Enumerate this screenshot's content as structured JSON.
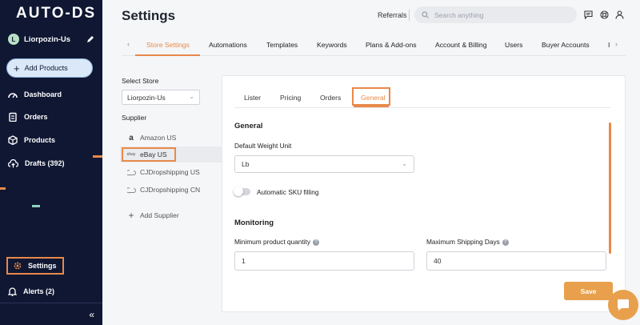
{
  "sidebar": {
    "logo": "AUTO-DS",
    "user": {
      "initial": "L",
      "name": "Liorpozin-Us"
    },
    "add_products": "Add Products",
    "nav": [
      {
        "label": "Dashboard",
        "icon": "speedometer-icon"
      },
      {
        "label": "Orders",
        "icon": "clipboard-icon"
      },
      {
        "label": "Products",
        "icon": "box-icon"
      },
      {
        "label": "Drafts (392)",
        "icon": "cloud-upload-icon"
      }
    ],
    "settings": "Settings",
    "alerts": "Alerts (2)",
    "collapse": "«"
  },
  "header": {
    "title": "Settings",
    "referrals": "Referrals",
    "search_placeholder": "Search anything"
  },
  "tabs": [
    {
      "label": "Store Settings",
      "active": true
    },
    {
      "label": "Automations"
    },
    {
      "label": "Templates"
    },
    {
      "label": "Keywords"
    },
    {
      "label": "Plans & Add-ons"
    },
    {
      "label": "Account & Billing"
    },
    {
      "label": "Users"
    },
    {
      "label": "Buyer Accounts"
    },
    {
      "label": "I"
    }
  ],
  "left": {
    "select_store_label": "Select Store",
    "store_value": "Liorpozin-Us",
    "supplier_label": "Supplier",
    "suppliers": [
      {
        "label": "Amazon US",
        "icon": "amazon-icon"
      },
      {
        "label": "eBay US",
        "icon": "ebay-icon",
        "badge": "ebay",
        "active": true
      },
      {
        "label": "CJDropshipping US",
        "icon": "cj-icon"
      },
      {
        "label": "CJDropshipping CN",
        "icon": "cj-icon"
      }
    ],
    "add_supplier": "Add Supplier"
  },
  "panel": {
    "subtabs": [
      {
        "label": "Lister"
      },
      {
        "label": "Pricing"
      },
      {
        "label": "Orders"
      },
      {
        "label": "General",
        "active": true
      }
    ],
    "general_title": "General",
    "weight_label": "Default Weight Unit",
    "weight_value": "Lb",
    "sku_label": "Automatic SKU filling",
    "sku_enabled": false,
    "monitoring_title": "Monitoring",
    "min_qty_label": "Minimum product quantity",
    "min_qty_value": "1",
    "max_ship_label": "Maximum Shipping Days",
    "max_ship_value": "40",
    "save": "Save"
  },
  "colors": {
    "accent": "#e8894a",
    "sidebar_bg": "#0f1733",
    "save_bg": "#e8a04c"
  }
}
